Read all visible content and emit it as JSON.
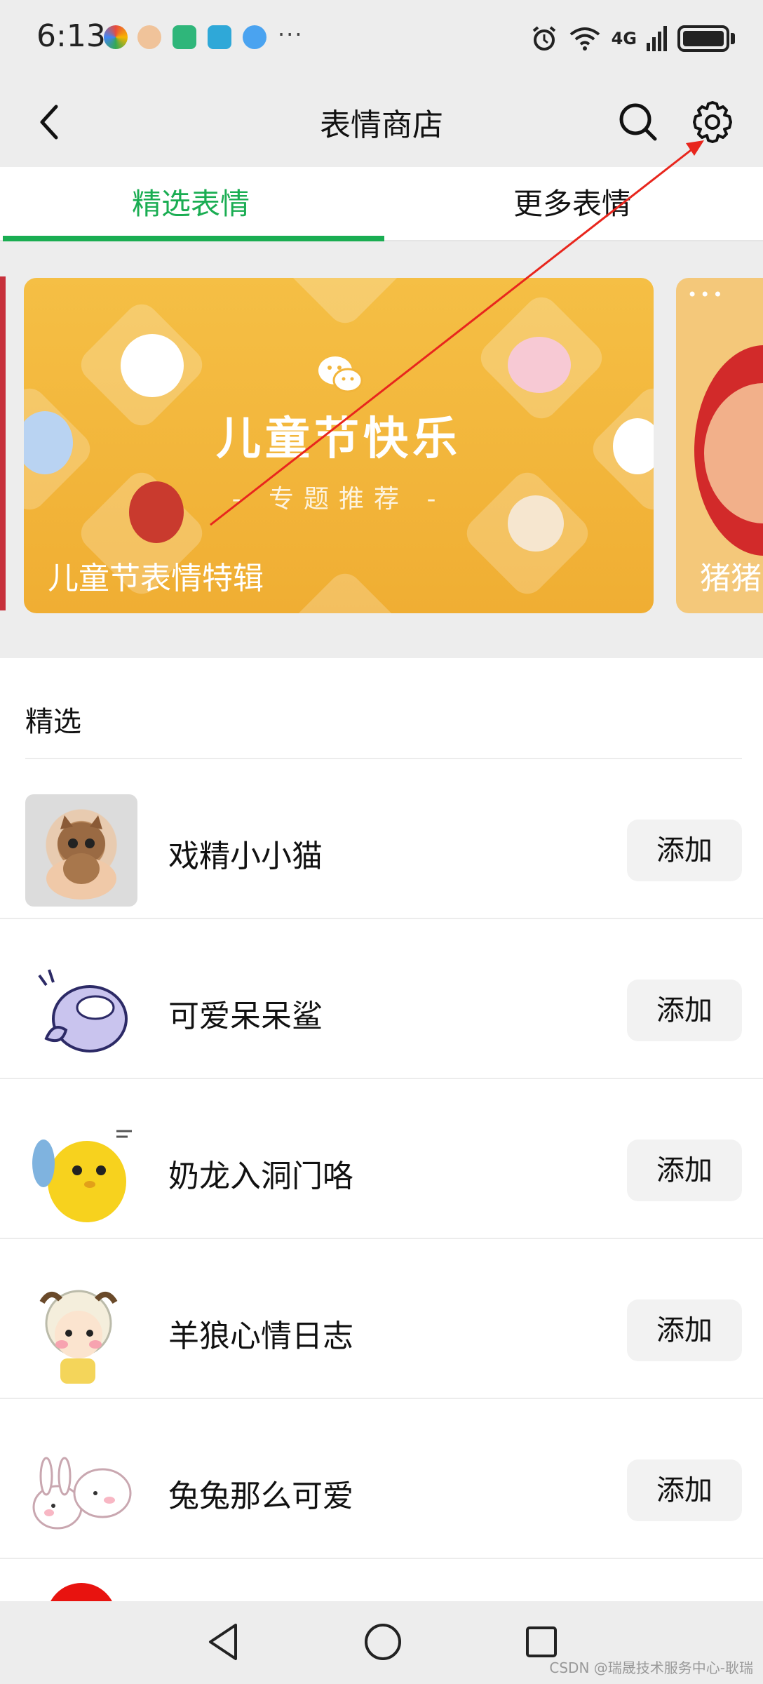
{
  "status_bar": {
    "time": "6:13",
    "more": "···",
    "network": "4G"
  },
  "nav": {
    "title": "表情商店",
    "back_icon": "chevron-left-icon",
    "search_icon": "search-icon",
    "settings_icon": "gear-icon"
  },
  "tabs": [
    {
      "label": "精选表情",
      "active": true
    },
    {
      "label": "更多表情",
      "active": false
    }
  ],
  "banner": {
    "headline": "儿童节快乐",
    "subtitle": "- 专题推荐 -",
    "caption": "儿童节表情特辑",
    "next_caption": "猪猪"
  },
  "featured": {
    "title": "精选",
    "packs": [
      {
        "name": "戏精小小猫",
        "button": "添加"
      },
      {
        "name": "可爱呆呆鲨",
        "button": "添加"
      },
      {
        "name": "奶龙入洞门咯",
        "button": "添加"
      },
      {
        "name": "羊狼心情日志",
        "button": "添加"
      },
      {
        "name": "兔兔那么可爱",
        "button": "添加"
      }
    ]
  },
  "watermark": "CSDN @瑞晟技术服务中心-耿瑞",
  "colors": {
    "accent": "#1aad52",
    "banner": "#f2b53b",
    "annotation_arrow": "#e8261d"
  }
}
